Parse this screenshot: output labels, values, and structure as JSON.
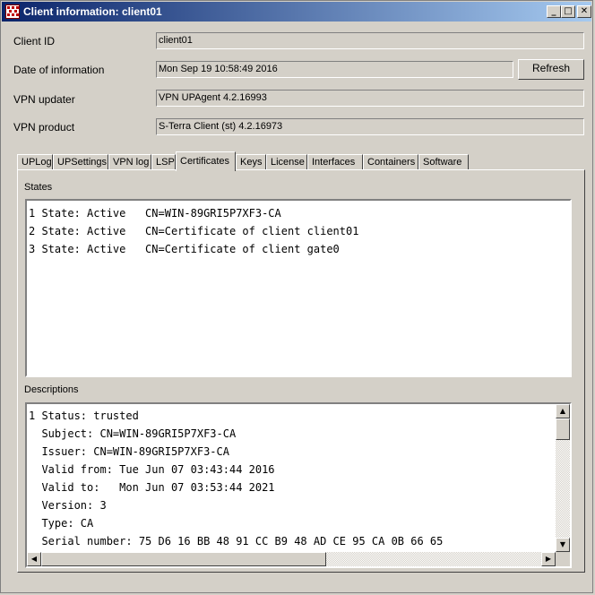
{
  "window": {
    "title": "Client information: client01"
  },
  "titlebar": {
    "minimize": "_",
    "maximize": "□",
    "close": "✕"
  },
  "fields": {
    "client_id": {
      "label": "Client ID",
      "value": "client01"
    },
    "date": {
      "label": "Date of information",
      "value": "Mon Sep 19 10:58:49 2016"
    },
    "vpn_updater": {
      "label": "VPN updater",
      "value": "VPN UPAgent 4.2.16993"
    },
    "vpn_product": {
      "label": "VPN product",
      "value": "S-Terra Client (st) 4.2.16973"
    }
  },
  "buttons": {
    "refresh": "Refresh"
  },
  "tabs": [
    "UPLog",
    "UPSettings",
    "VPN log",
    "LSP",
    "Certificates",
    "Keys",
    "License",
    "Interfaces",
    "Containers",
    "Software"
  ],
  "active_tab": "Certificates",
  "states": {
    "label": "States",
    "lines": [
      "1 State: Active   CN=WIN-89GRI5P7XF3-CA",
      "2 State: Active   CN=Certificate of client client01",
      "3 State: Active   CN=Certificate of client gate0"
    ]
  },
  "descriptions": {
    "label": "Descriptions",
    "lines": [
      "1 Status: trusted",
      "  Subject: CN=WIN-89GRI5P7XF3-CA",
      "  Issuer: CN=WIN-89GRI5P7XF3-CA",
      "  Valid from: Tue Jun 07 03:43:44 2016",
      "  Valid to:   Mon Jun 07 03:53:44 2021",
      "  Version: 3",
      "  Type: CA",
      "  Serial number: 75 D6 16 BB 48 91 CC B9 48 AD CE 95 CA 0B 66 65"
    ]
  },
  "scroll": {
    "up": "▲",
    "down": "▼",
    "left": "◀",
    "right": "▶"
  }
}
